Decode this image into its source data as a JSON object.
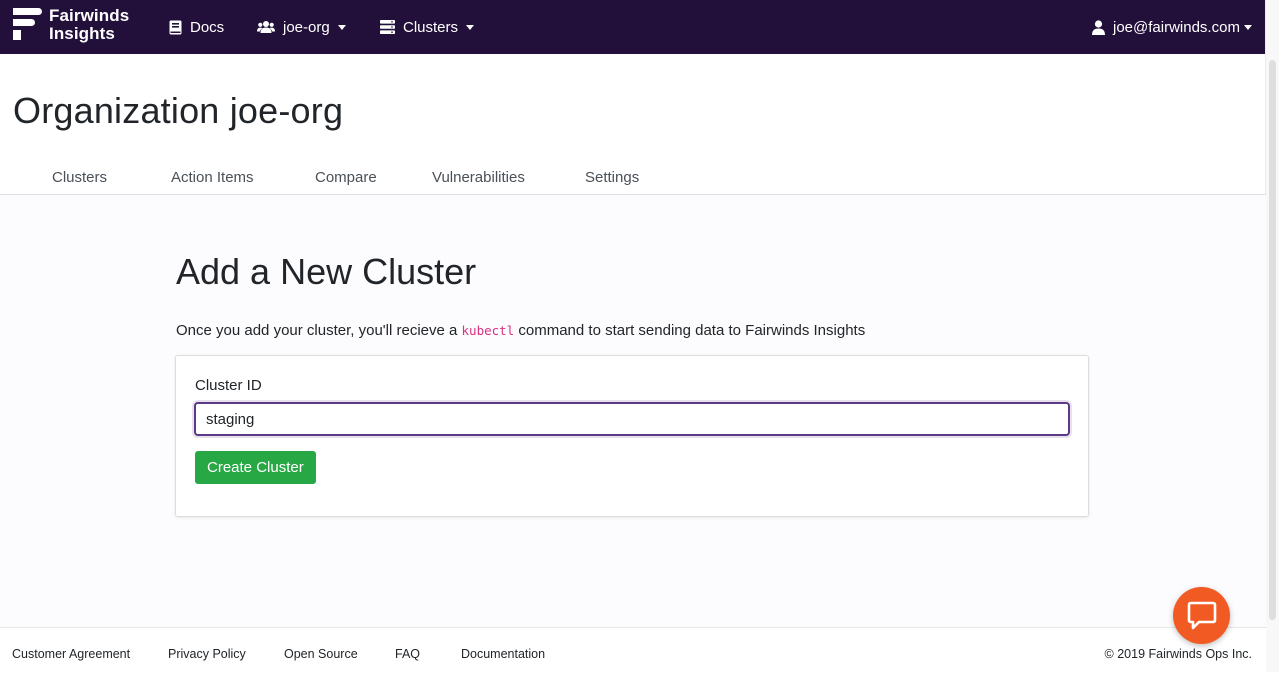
{
  "brand": {
    "line1": "Fairwinds",
    "line2": "Insights"
  },
  "nav": {
    "docs": "Docs",
    "org": "joe-org",
    "clusters": "Clusters",
    "user": "joe@fairwinds.com"
  },
  "org_page": {
    "title": "Organization joe-org",
    "tabs": [
      {
        "label": "Clusters"
      },
      {
        "label": "Action Items"
      },
      {
        "label": "Compare"
      },
      {
        "label": "Vulnerabilities"
      },
      {
        "label": "Settings"
      }
    ]
  },
  "add_cluster": {
    "title": "Add a New Cluster",
    "intro_before": "Once you add your cluster, you'll recieve a ",
    "intro_code": "kubectl",
    "intro_after": " command to start sending data to Fairwinds Insights",
    "field_label": "Cluster ID",
    "field_value": "staging",
    "button_label": "Create Cluster"
  },
  "footer": {
    "links": [
      {
        "label": "Customer Agreement"
      },
      {
        "label": "Privacy Policy"
      },
      {
        "label": "Open Source"
      },
      {
        "label": "FAQ"
      },
      {
        "label": "Documentation"
      }
    ],
    "copyright": "© 2019 Fairwinds Ops Inc."
  },
  "icons": {
    "docs": "book-icon",
    "org": "users-icon",
    "clusters": "server-icon",
    "user": "user-icon",
    "chat": "chat-icon"
  },
  "colors": {
    "navbar": "#23103a",
    "primary_button": "#28a745",
    "input_focus": "#5b3a86",
    "chat_button": "#f15a22",
    "code": "#d63384"
  }
}
